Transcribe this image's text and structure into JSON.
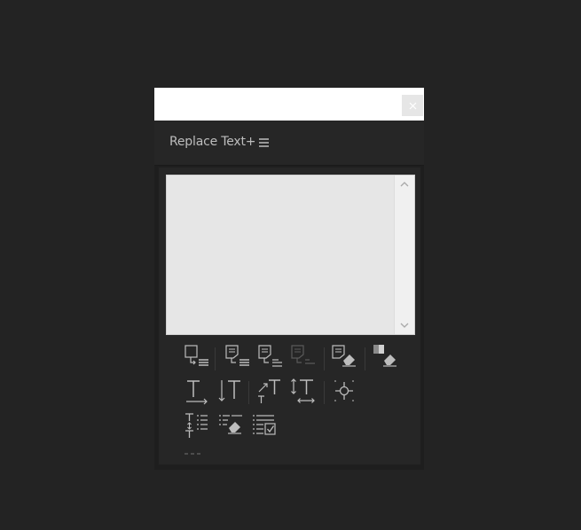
{
  "panel": {
    "title": "Replace Text+"
  },
  "icons": {
    "close": "close-icon",
    "menu": "hamburger-menu-icon",
    "scroll_up": "chevron-up-icon",
    "scroll_down": "chevron-down-icon",
    "more": "more-options-icon"
  },
  "colors": {
    "window_bg": "#232323",
    "panel_bg": "#262626",
    "titlebar_bg": "#ffffff",
    "text_field_bg": "#e6e6e6",
    "icon_color": "#bdbdbd",
    "icon_disabled": "#5a5a5a",
    "title_text": "#bdbdbd"
  },
  "text_field": {
    "value": ""
  }
}
